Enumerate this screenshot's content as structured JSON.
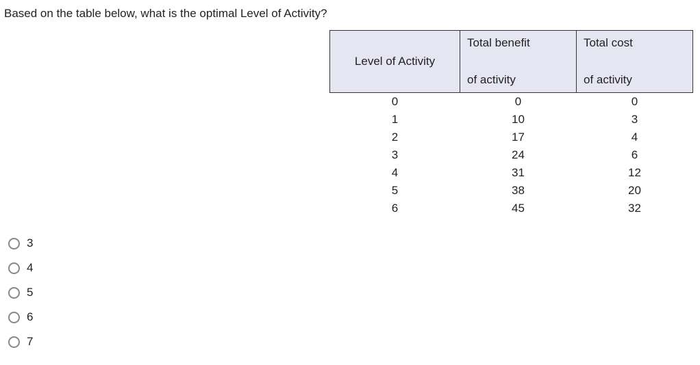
{
  "question": "Based on the table below, what is the optimal Level of Activity?",
  "table": {
    "headers": {
      "col1": "Level of Activity",
      "col2_line1": "Total benefit",
      "col2_line2": "of activity",
      "col3_line1": "Total cost",
      "col3_line2": "of activity"
    },
    "rows": [
      {
        "level": "0",
        "benefit": "0",
        "cost": "0"
      },
      {
        "level": "1",
        "benefit": "10",
        "cost": "3"
      },
      {
        "level": "2",
        "benefit": "17",
        "cost": "4"
      },
      {
        "level": "3",
        "benefit": "24",
        "cost": "6"
      },
      {
        "level": "4",
        "benefit": "31",
        "cost": "12"
      },
      {
        "level": "5",
        "benefit": "38",
        "cost": "20"
      },
      {
        "level": "6",
        "benefit": "45",
        "cost": "32"
      }
    ]
  },
  "options": [
    {
      "label": "3"
    },
    {
      "label": "4"
    },
    {
      "label": "5"
    },
    {
      "label": "6"
    },
    {
      "label": "7"
    }
  ]
}
